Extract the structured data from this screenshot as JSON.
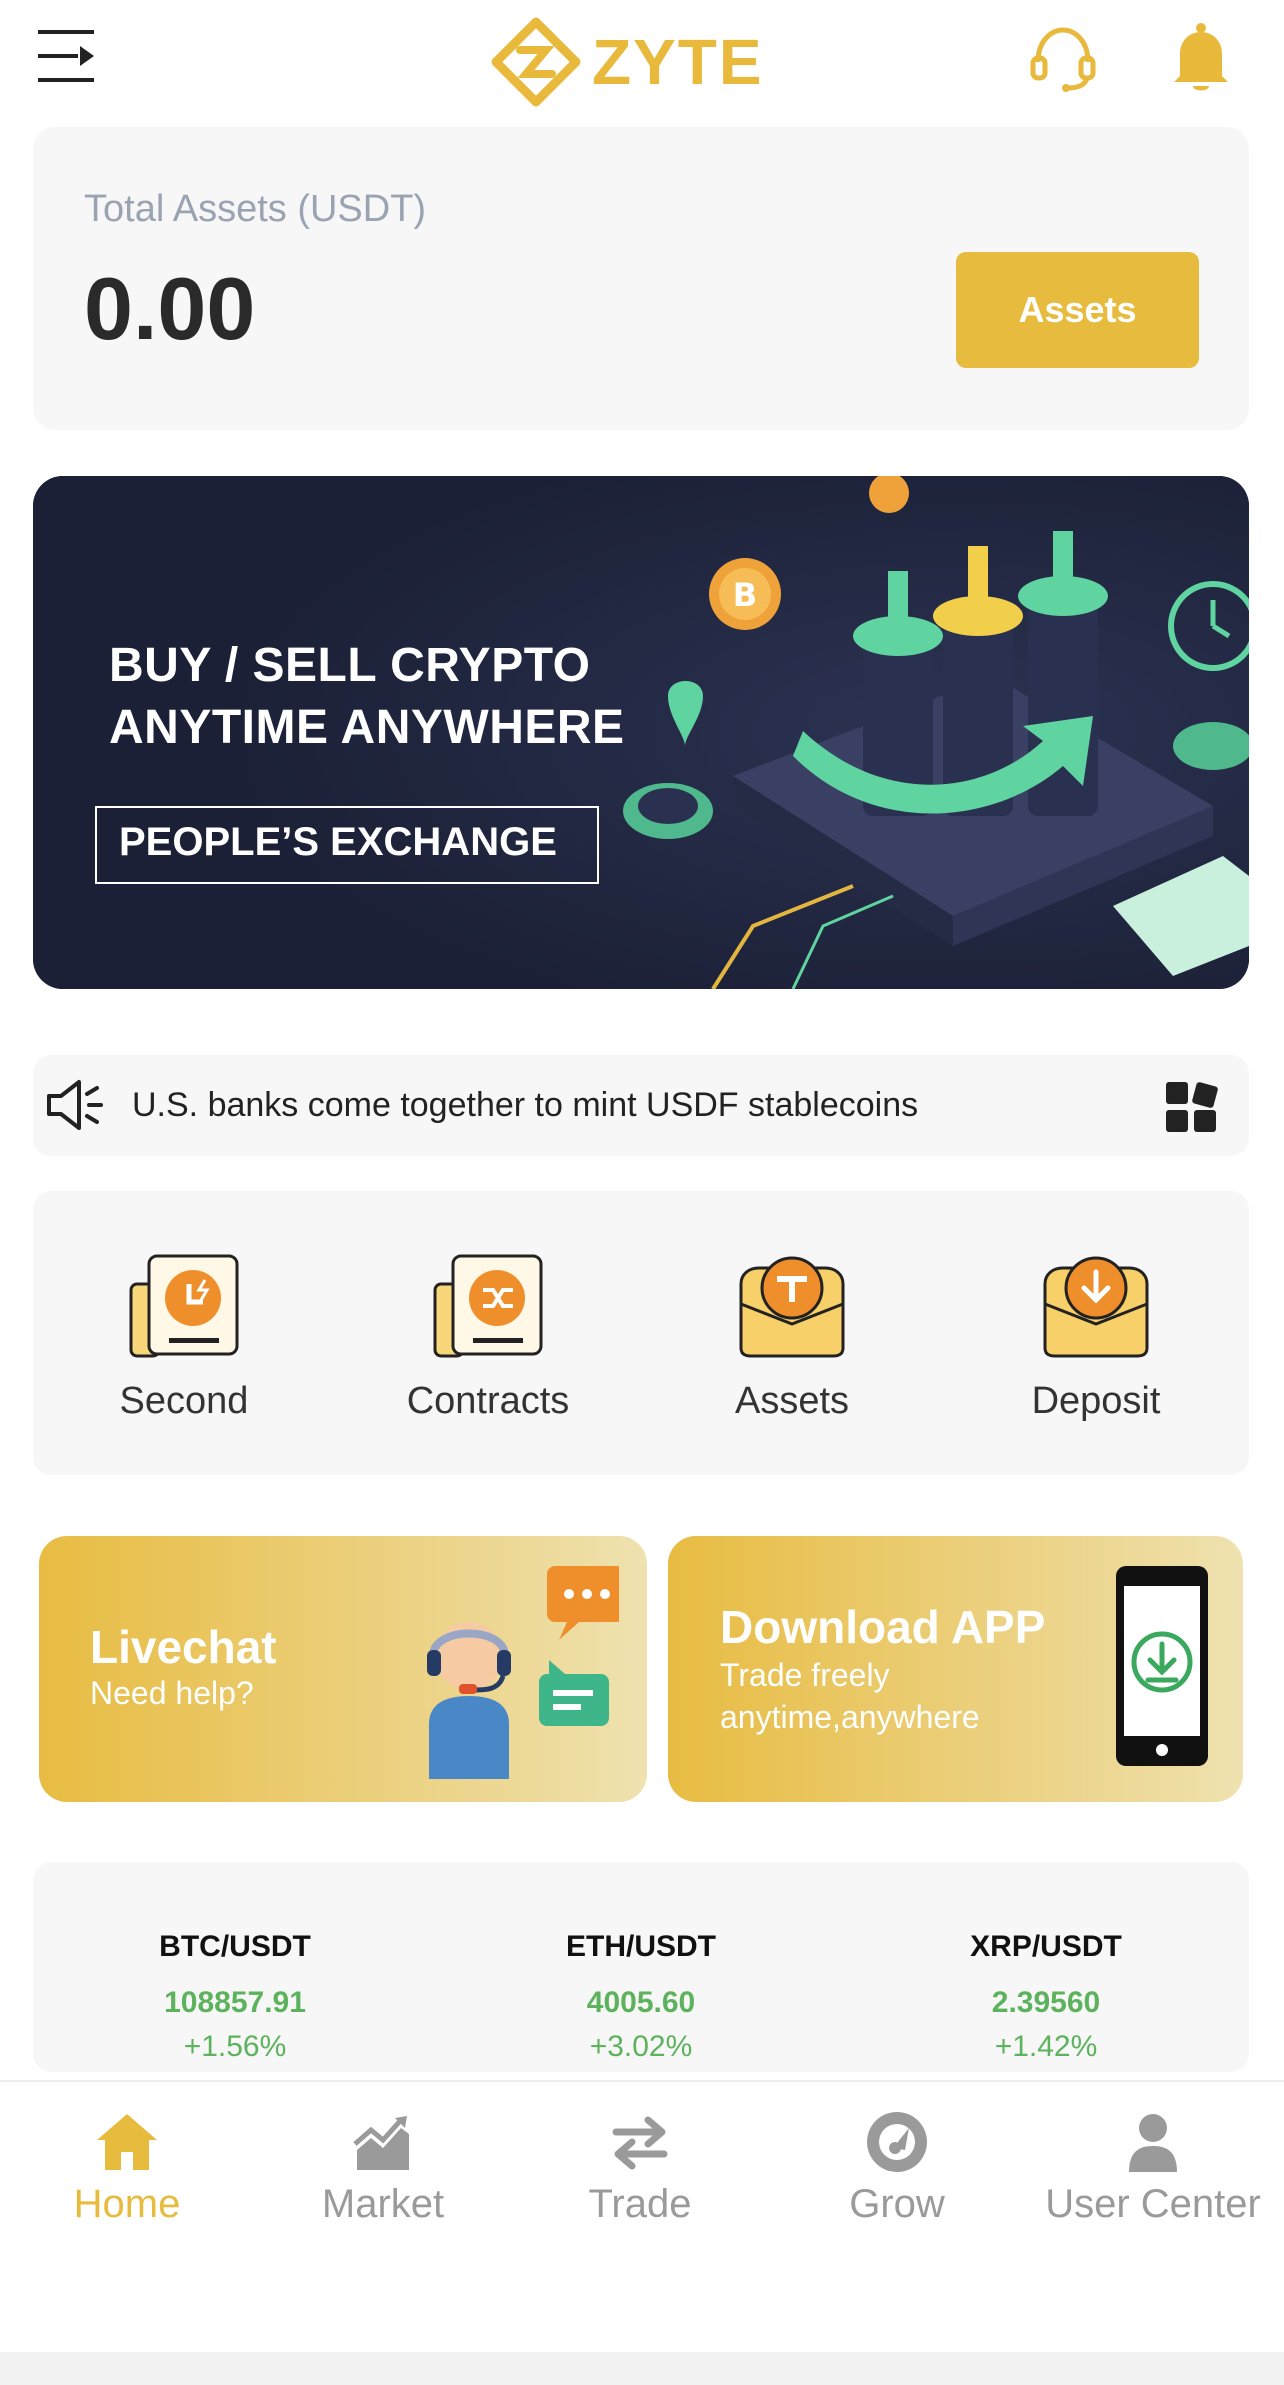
{
  "header": {
    "brand": "ZYTE",
    "icons": [
      "menu-icon",
      "headset-icon",
      "bell-icon"
    ]
  },
  "total_assets": {
    "label": "Total Assets (USDT)",
    "value": "0.00",
    "button_label": "Assets"
  },
  "banner": {
    "line1": "BUY / SELL CRYPTO",
    "line2": "ANYTIME ANYWHERE",
    "tag": "PEOPLE’S EXCHANGE"
  },
  "news": {
    "text": "U.S. banks come together to mint USDF stablecoins"
  },
  "quick_menu": [
    {
      "label": "Second",
      "icon": "second-icon"
    },
    {
      "label": "Contracts",
      "icon": "contracts-icon"
    },
    {
      "label": "Assets",
      "icon": "assets-icon"
    },
    {
      "label": "Deposit",
      "icon": "deposit-icon"
    }
  ],
  "promos": {
    "livechat": {
      "title": "Livechat",
      "subtitle": "Need help?"
    },
    "download": {
      "title": "Download APP",
      "subtitle_line1": "Trade freely",
      "subtitle_line2": "anytime,anywhere"
    }
  },
  "tickers": [
    {
      "pair": "BTC/USDT",
      "price": "108857.91",
      "change": "+1.56%"
    },
    {
      "pair": "ETH/USDT",
      "price": "4005.60",
      "change": "+3.02%"
    },
    {
      "pair": "XRP/USDT",
      "price": "2.39560",
      "change": "+1.42%"
    }
  ],
  "bottom_nav": [
    {
      "label": "Home",
      "icon": "home-icon",
      "active": true
    },
    {
      "label": "Market",
      "icon": "market-icon",
      "active": false
    },
    {
      "label": "Trade",
      "icon": "trade-icon",
      "active": false
    },
    {
      "label": "Grow",
      "icon": "grow-icon",
      "active": false
    },
    {
      "label": "User Center",
      "icon": "user-icon",
      "active": false
    }
  ],
  "colors": {
    "accent": "#E7BC3E",
    "positive": "#5db35d",
    "banner_bg": "#1b2036",
    "card_bg": "#f7f7f7"
  }
}
